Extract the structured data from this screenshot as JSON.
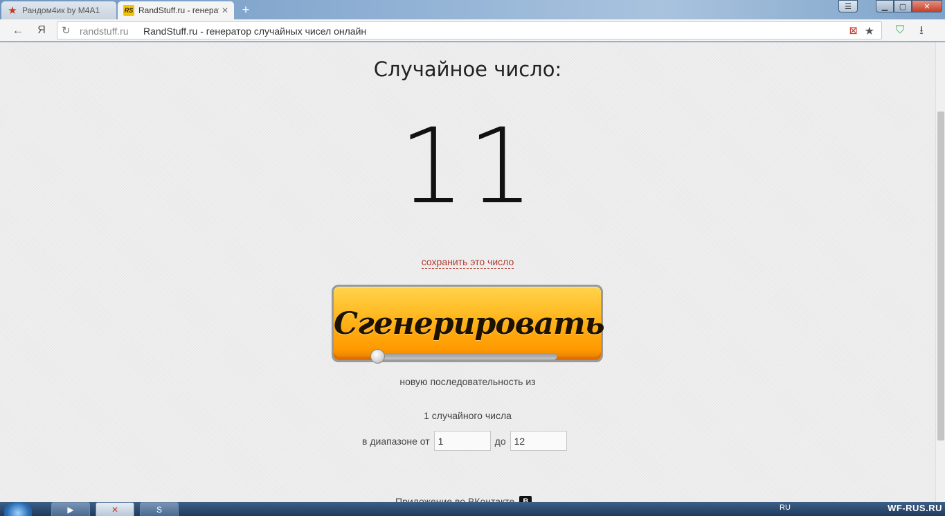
{
  "browser": {
    "tabs": [
      {
        "title": "Рандом4ик by M4A1",
        "favicon": "red-star-icon",
        "active": false
      },
      {
        "title": "RandStuff.ru - генерат",
        "favicon": "rs-logo-icon",
        "active": true
      }
    ],
    "address": {
      "domain": "randstuff.ru",
      "page_title": "RandStuff.ru - генератор случайных чисел онлайн"
    },
    "yandex_label": "Я"
  },
  "page": {
    "heading": "Случайное число:",
    "result": "11",
    "save_link": "сохранить это число",
    "generate_button": "Сгенерировать",
    "sequence_label": "новую последовательность из",
    "sequence_count": 1,
    "count_label": "1 случайного числа",
    "range_from_label": "в диапазоне от",
    "range_from_value": "1",
    "range_to_label": "до",
    "range_to_value": "12",
    "footer_link": "Приложение во ВКонтакте",
    "vk_badge": "В"
  },
  "taskbar": {
    "tray_lang": "RU",
    "watermark": "WF-RUS.RU"
  },
  "colors": {
    "button_orange": "#ffa400",
    "link_red": "#b03a2e",
    "page_bg": "#ececec"
  }
}
